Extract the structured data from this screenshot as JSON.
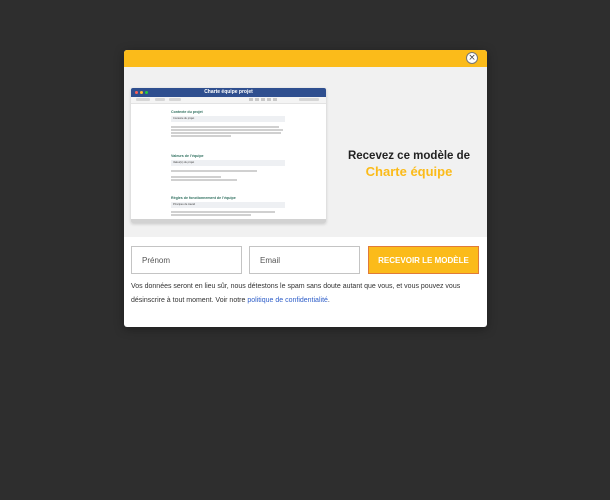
{
  "modal": {
    "close_label": "×",
    "preview": {
      "title": "Charte équipe projet",
      "sections": [
        {
          "title": "Contexte du projet",
          "field": "Contexte du projet"
        },
        {
          "title": "Valeurs de l’équipe",
          "field": "Valeur(s) du projet"
        },
        {
          "title": "Règles de fonctionnement de l’équipe",
          "field": "Principes de travail"
        }
      ]
    },
    "headline_line1": "Recevez ce modèle de",
    "headline_line2": "Charte équipe",
    "form": {
      "first_name_placeholder": "Prénom",
      "email_placeholder": "Email",
      "submit_label": "RECEVOIR LE MODÈLE"
    },
    "privacy_text": "Vos données seront en lieu sûr, nous détestons le spam sans doute autant que vous, et vous pouvez vous désinscrire à tout moment. Voir notre ",
    "privacy_link": "politique de confidentialité",
    "privacy_end": "."
  },
  "colors": {
    "accent": "#fbbb1a",
    "page_background": "#2e2e2e",
    "link": "#2e5ec9",
    "doc_header": "#2f4f8f"
  }
}
